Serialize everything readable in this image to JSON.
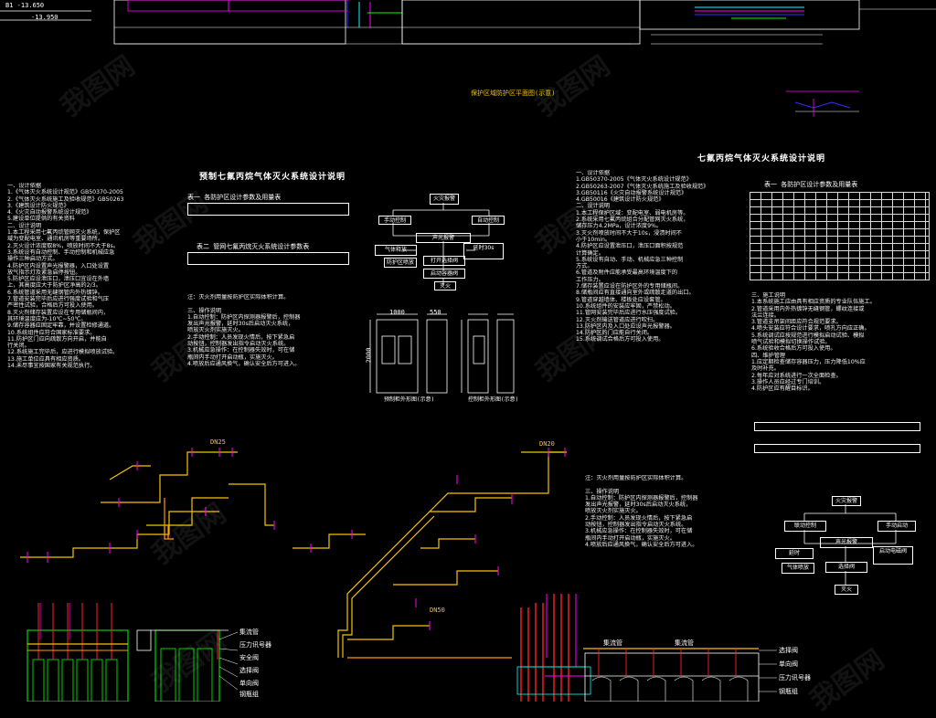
{
  "drawing": {
    "main_title": "预制七氟丙烷气体灭火系统设计说明",
    "right_title": "七氟丙烷气体灭火系统设计说明",
    "top_caption": "保护区域防护区平面图(示意)",
    "elev_top_left_1": "B1   -13.650",
    "elev_top_left_2": "-13.950",
    "cabinet_caption_left": "预制柜外形图(示意)",
    "cabinet_caption_right": "控制柜外形图(示意)",
    "cabinet_dim_width": "1000",
    "cabinet_dim_depth": "550",
    "cabinet_dim_height": "2000",
    "table1_title": "表一 各防护区设计参数及用量表",
    "table2_title": "表二 管网七氟丙烷灭火系统设计参数表",
    "right_table_title": "表一 各防护区设计参数及用量表"
  },
  "flowchart": {
    "nodes": [
      "火灾报警",
      "手动控制",
      "自动控制",
      "声光报警",
      "气体释放",
      "延时30s",
      "打开选择阀",
      "启动容器阀",
      "防护区喷放",
      "灭火"
    ]
  },
  "right_flowchart": {
    "nodes": [
      "火灾报警",
      "联动控制",
      "手动启动",
      "声光报警",
      "延时",
      "启动电磁阀",
      "选择阀",
      "气体喷放",
      "灭火"
    ]
  },
  "pipe_labels": {
    "main_pipe": "DN50",
    "branch": "DN25",
    "nozzle": "DN20",
    "collector": "集流管",
    "pressure_switch": "压力讯号器",
    "safety_valve": "安全阀",
    "selector_valve": "选择阀",
    "check_valve": "单向阀",
    "cylinder": "钢瓶组",
    "header_label": "集流管",
    "manifold_right": "集流管"
  },
  "colors": {
    "background": "#000000",
    "pipe_yellow": "#f5c400",
    "pipe_orange": "#ff9a00",
    "magenta": "#ff00ff",
    "cyan": "#00ffff",
    "green": "#00ff00",
    "red": "#ff2020",
    "blue": "#3030ff",
    "white": "#ffffff"
  },
  "left_notes": "一、设计依据\n1.《气体灭火系统设计规范》GB50370-2005\n2.《气体灭火系统施工及验收规范》GB50263\n3.《建筑设计防火规范》\n4.《火灾自动报警系统设计规范》\n5.建设单位提供的有关资料\n二、设计说明\n1.本工程采用七氟丙烷管网灭火系统，保护区\n域为变配电室、通讯机房等重要场所。\n2.灭火设计浓度取8%，喷放时间不大于8s。\n3.系统设有自动控制、手动控制和机械应急\n操作三种启动方式。\n4.防护区内设置声光报警器，入口处设置\n放气指示灯及紧急启停按钮。\n5.防护区应设泄压口，泄压口宜设在外墙\n上，其高度应大于防护区净高的2/3。\n6.系统管道采用无缝钢管内外热镀锌。\n7.管道安装完毕后应进行强度试验和气压\n严密性试验，合格后方可投入使用。\n8.灭火剂储存装置应设在专用储瓶间内，\n其环境温度应为-10℃~50℃。\n9.储存容器应固定牢靠，并设置检修通道。\n10.系统组件应符合国家标准要求。\n11.防护区门应向疏散方向开启，并能自\n行关闭。\n12.系统施工完毕后，应进行模拟喷放试验。\n13.施工单位应具有相应资质。\n14.未尽事宜按国家有关规范执行。",
  "mid_notes": "注：灭火剂用量按防护区实际体积计算。\n\n三、操作说明\n1.自动控制：防护区内探测器报警后，控制器\n发出声光报警，延时30s后启动灭火系统，\n喷放灭火剂实施灭火。\n2.手动控制：人员发现火情后，按下紧急启\n动按钮，控制器发出指令启动灭火系统。\n3.机械应急操作：在控制器失效时，可在储\n瓶间内手动打开启动瓶，实施灭火。\n4.喷放后应通风换气，确认安全后方可进入。",
  "right_notes": "一、设计依据\n1.GB50370-2005《气体灭火系统设计规范》\n2.GB50263-2007《气体灭火系统施工及验收规范》\n3.GB50116《火灾自动报警系统设计规范》\n4.GB50016《建筑设计防火规范》\n二、设计说明\n1.本工程保护区域：变配电室、弱电机房等。\n2.系统采用七氟丙烷组合分配管网灭火系统，\n储存压力4.2MPa，设计浓度9%。\n3.灭火剂喷放时间不大于10s，浸渍时间不\n小于10min。\n4.防护区应设置泄压口，泄压口面积按规范\n计算确定。\n5.系统设有自动、手动、机械应急三种控制\n方式。\n6.管道及附件应能承受最高环境温度下的\n工作压力。\n7.储存装置应设在防护区外的专用储瓶间。\n8.储瓶间应有直接通向室外或疏散走道的出口。\n9.管道穿越墙体、楼板处应设套管。\n10.系统组件的安装应牢固，严禁松动。\n11.管网安装完毕后应进行水压强度试验。\n12.灭火剂输送管道应进行吹扫。\n13.防护区内及入口处应设声光报警器。\n14.防护区的门应能自行关闭。\n15.系统调试合格后方可投入使用。",
  "right_notes2": "三、施工说明\n1.本系统施工应由具有相应资质的专业队伍施工。\n2.管道采用内外热镀锌无缝钢管，螺纹连接或\n法兰连接。\n3.管道支吊架间距应符合规范要求。\n4.喷头安装应符合设计要求，喷孔方向应正确。\n5.系统调试应按规范进行模拟启动试验、模拟\n喷气试验和模拟切换操作试验。\n6.系统验收合格后方可投入使用。\n四、维护管理\n1.应定期检查储存容器压力，压力降低10%应\n及时补充。\n2.每年应对系统进行一次全面检查。\n3.操作人员应经过专门培训。\n4.防护区应有醒目标识。",
  "watermark": "我图网"
}
